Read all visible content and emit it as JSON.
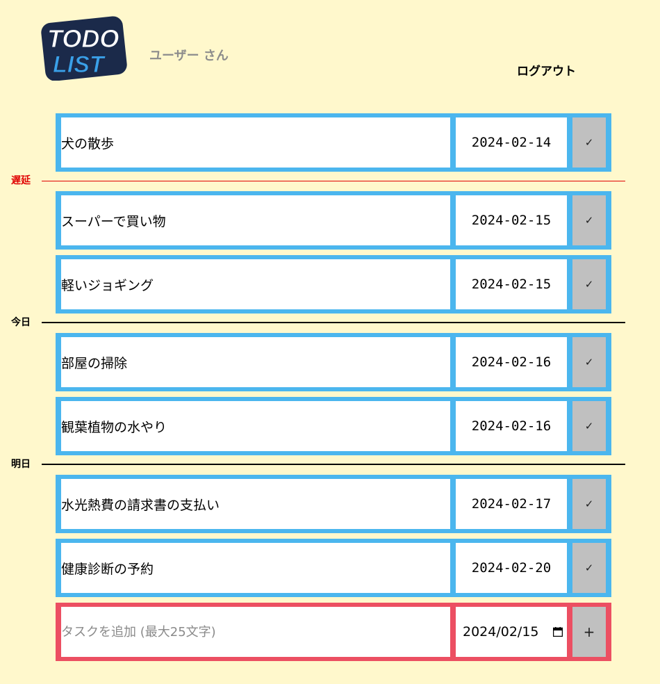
{
  "header": {
    "logo": "TODO LIST",
    "username": "ユーザー さん",
    "logout_label": "ログアウト"
  },
  "sections": {
    "late_label": "遅延",
    "today_label": "今日",
    "tomorrow_label": "明日"
  },
  "tasks": [
    {
      "title": "犬の散歩",
      "date": "2024-02-14"
    },
    {
      "title": "スーパーで買い物",
      "date": "2024-02-15"
    },
    {
      "title": "軽いジョギング",
      "date": "2024-02-15"
    },
    {
      "title": "部屋の掃除",
      "date": "2024-02-16"
    },
    {
      "title": "観葉植物の水やり",
      "date": "2024-02-16"
    },
    {
      "title": "水光熱費の請求書の支払い",
      "date": "2024-02-17"
    },
    {
      "title": "健康診断の予約",
      "date": "2024-02-20"
    }
  ],
  "complete_symbol": "✓",
  "new_task": {
    "placeholder": "タスクを追加 (最大25文字)",
    "date": "2024/02/15",
    "add_symbol": "+"
  },
  "colors": {
    "background": "#fff8cc",
    "task_border": "#4bb6ee",
    "new_task_border": "#ec4f62",
    "late": "#e00000",
    "button": "#c0c0c0"
  }
}
